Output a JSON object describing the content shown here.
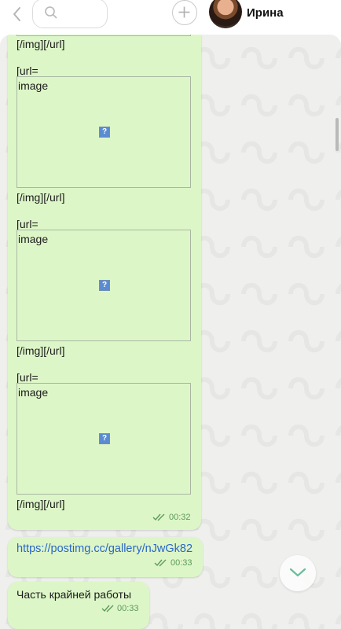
{
  "header": {
    "contact_name": "Ирина"
  },
  "messages": [
    {
      "lines": [
        "[/img][/url]",
        "[url=",
        "[/img][/url]",
        "[url=",
        "[/img][/url]",
        "[url=",
        "[/img][/url]"
      ],
      "image_alt": "image",
      "time": "00:32",
      "status": "read"
    },
    {
      "text": "https://postimg.cc/gallery/nJwGk82",
      "time": "00:33",
      "status": "read"
    },
    {
      "text": "Часть крайней работы",
      "time": "00:33",
      "status": "read"
    }
  ],
  "broken_image_glyph": "?",
  "icons": [
    "back-chevron-icon",
    "search-icon",
    "plus-icon",
    "double-check-icon",
    "chevron-down-icon"
  ],
  "colors": {
    "outgoing_bubble": "#ddf6c8",
    "link": "#2a66c8",
    "timestamp": "#5e9a5a"
  }
}
